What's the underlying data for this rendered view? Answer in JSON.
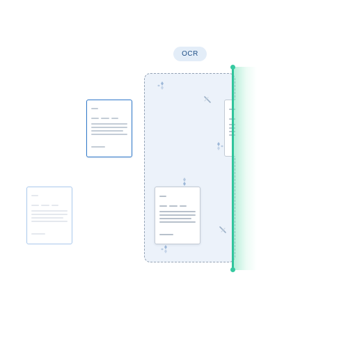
{
  "badge": {
    "label": "OCR"
  },
  "colors": {
    "accent_blue": "#2f78c9",
    "scan_green": "#2fc49b",
    "zone_fill": "#ecf2fa",
    "badge_bg": "#e3edf8"
  },
  "icons": {
    "sparkle": "sparkle-icon",
    "slash": "slash-icon"
  },
  "documents": [
    {
      "name": "doc-selected",
      "state": "selected"
    },
    {
      "name": "doc-faded",
      "state": "inactive"
    },
    {
      "name": "doc-scanned",
      "state": "scanned"
    },
    {
      "name": "doc-passing",
      "state": "being-scanned"
    }
  ]
}
